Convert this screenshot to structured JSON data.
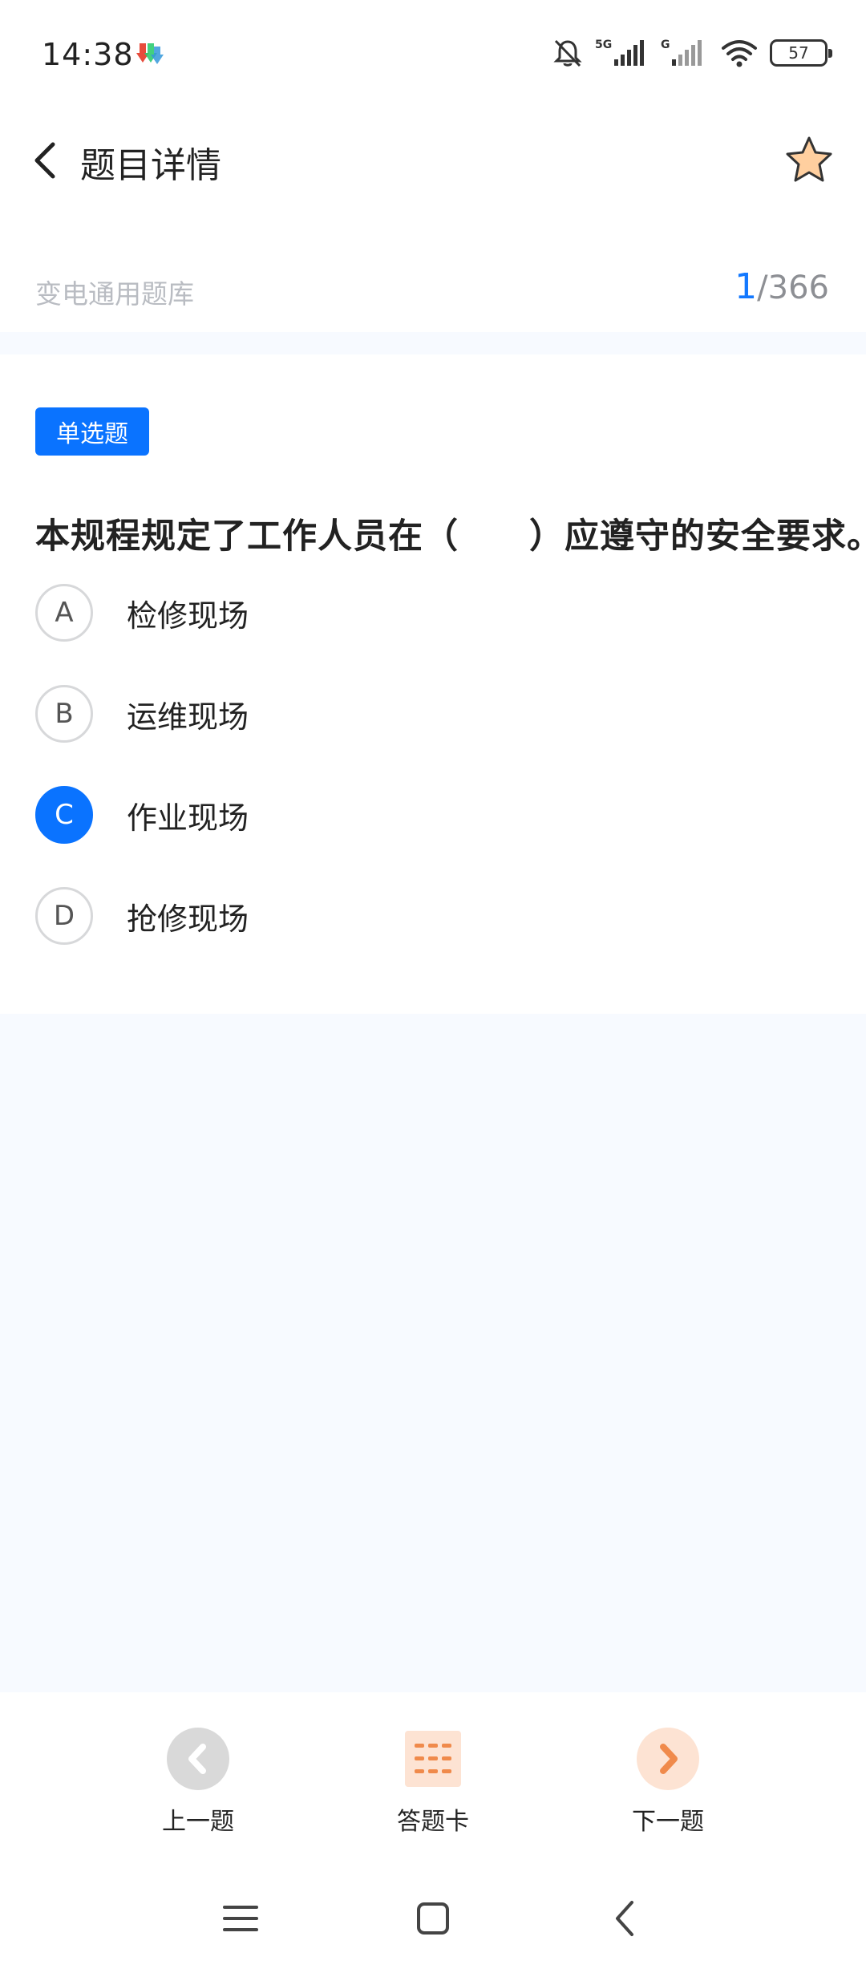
{
  "status_bar": {
    "time": "14:38",
    "battery": "57",
    "network_5g": "5G",
    "network_g": "G",
    "icons": [
      "download-app-icon",
      "bell-muted-icon",
      "signal-5g-icon",
      "signal-g-icon",
      "wifi-icon",
      "battery-icon"
    ]
  },
  "header": {
    "title": "题目详情",
    "back_icon": "chevron-left-icon",
    "favorite_icon": "star-icon"
  },
  "bank": {
    "name": "变电通用题库",
    "current": "1",
    "total": "/366"
  },
  "question": {
    "type": "单选题",
    "text": "本规程规定了工作人员在（　　）应遵守的安全要求。",
    "options": [
      {
        "letter": "A",
        "text": "检修现场",
        "selected": false
      },
      {
        "letter": "B",
        "text": "运维现场",
        "selected": false
      },
      {
        "letter": "C",
        "text": "作业现场",
        "selected": true
      },
      {
        "letter": "D",
        "text": "抢修现场",
        "selected": false
      }
    ]
  },
  "bottom_nav": {
    "prev_label": "上一题",
    "card_label": "答题卡",
    "next_label": "下一题"
  },
  "colors": {
    "accent": "#0a73ff",
    "orange": "#f08a4b",
    "orange_light": "#fde3d3",
    "gray_button": "#d9d9d9"
  }
}
